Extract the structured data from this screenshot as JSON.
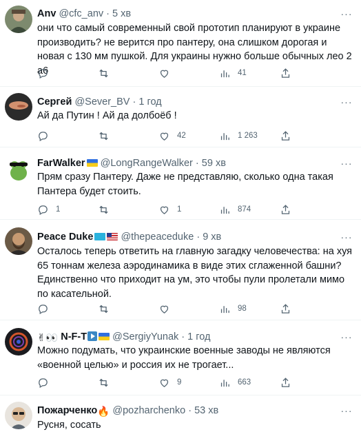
{
  "tweets": [
    {
      "name": "Anv",
      "handle": "@cfc_anv",
      "time": "5 хв",
      "text": "они что самый современный свой прототип планируют в украине производить? не верится про пантеру, она слишком дорогая и новая с 130 мм пушкой. Для украины нужно больше обычных лео 2 а6",
      "replies": "",
      "retweets": "",
      "likes": "",
      "views": "41"
    },
    {
      "name": "Сергей",
      "handle": "@Sever_BV",
      "time": "1 год",
      "text": "Ай да Путин ! Ай да долбоёб !",
      "replies": "",
      "retweets": "",
      "likes": "42",
      "views": "1 263"
    },
    {
      "name": "FarWalker",
      "handle": "@LongRangeWalker",
      "time": "59 хв",
      "text": "Прям сразу Пантеру. Даже не представляю, сколько одна такая Пантера будет стоить.",
      "replies": "1",
      "retweets": "",
      "likes": "1",
      "views": "874"
    },
    {
      "name": "Peace Duke",
      "handle": "@thepeaceduke",
      "time": "9 хв",
      "text": "Осталось теперь ответить на главную загадку человечества: на хуя 65 тоннам железа аэродинамика в виде этих сглаженной башни? Единственно что приходит на ум, это чтобы пули пролетали мимо по касательной.",
      "replies": "",
      "retweets": "",
      "likes": "",
      "views": "98"
    },
    {
      "name": "N-F-T",
      "handle": "@SergiyYunak",
      "time": "1 год",
      "text": "Можно подумать, что украинские военные заводы не являются «военной целью» и россия их не трогает...",
      "replies": "",
      "retweets": "",
      "likes": "9",
      "views": "663"
    },
    {
      "name": "Пожарченко",
      "handle": "@pozharchenko",
      "time": "53 хв",
      "text": "Русня, сосать"
    }
  ],
  "ui": {
    "dot": "·",
    "more": "···"
  },
  "colors": {
    "text": "#0f1419",
    "secondary": "#536471",
    "divider": "#eff3f4"
  }
}
